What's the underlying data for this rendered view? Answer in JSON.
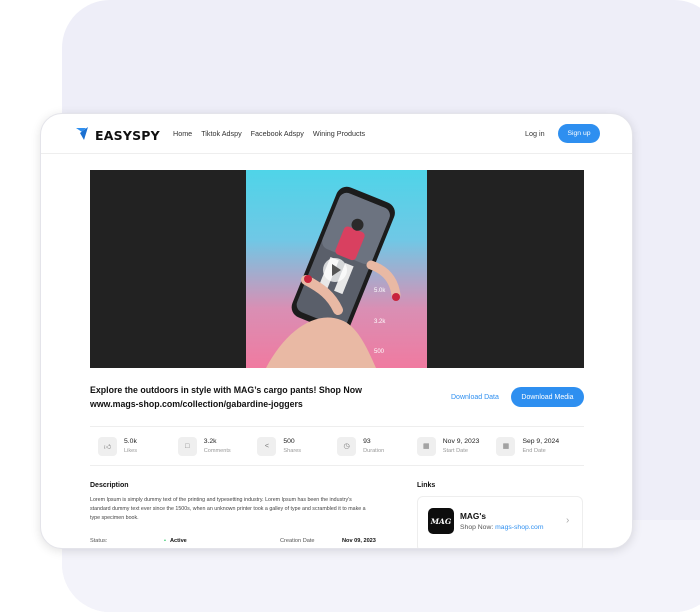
{
  "header": {
    "brand": "EASYSPY",
    "nav_items": [
      "Home",
      "Tiktok Adspy",
      "Facebook Adspy",
      "Wining Products"
    ],
    "login": "Log in",
    "signup": "Sign up"
  },
  "video": {
    "overlay": {
      "likes": "5.0k",
      "comments": "3.2k",
      "shares": "500"
    }
  },
  "ad": {
    "title": "Explore the outdoors in style with MAG’s cargo pants! Shop Now www.mags-shop.com/collection/gabardine-joggers",
    "download_data": "Download Data",
    "download_media": "Download Media"
  },
  "stats": [
    {
      "icon": "thumbs-up-icon",
      "value": "5.0k",
      "label": "Likes"
    },
    {
      "icon": "comment-icon",
      "value": "3.2k",
      "label": "Comments"
    },
    {
      "icon": "share-icon",
      "value": "500",
      "label": "Shares"
    },
    {
      "icon": "clock-icon",
      "value": "93",
      "label": "Duration"
    },
    {
      "icon": "calendar-icon",
      "value": "Nov 9, 2023",
      "label": "Start Date"
    },
    {
      "icon": "calendar-icon",
      "value": "Sep 9, 2024",
      "label": "End Date"
    }
  ],
  "description": {
    "heading": "Description",
    "text": "Lorem Ipsum is simply dummy text of the printing and typesetting industry. Lorem Ipsum has been the industry's standard dummy text ever since the 1500s, when an unknown printer took a galley of type and scrambled it to make a type specimen book."
  },
  "details": {
    "status_label": "Status:",
    "status_value": "Active",
    "creation_label": "Creation Date",
    "creation_value": "Nov 09, 2023"
  },
  "links": {
    "heading": "Links",
    "shop_logo": "MAG",
    "shop_name": "MAG's",
    "shop_prefix": "Shop Now:",
    "shop_url": "mags-shop.com"
  },
  "colors": {
    "accent": "#2e8ff0",
    "status_active": "#22c55e"
  }
}
